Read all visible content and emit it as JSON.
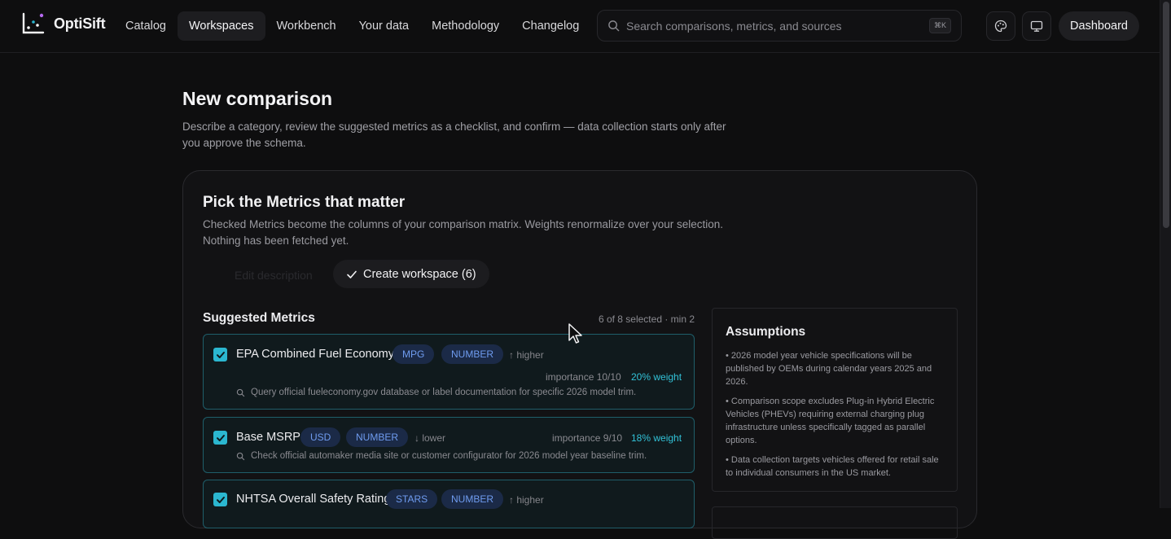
{
  "brand": {
    "name": "OptiSift"
  },
  "nav": [
    {
      "label": "Catalog",
      "active": false
    },
    {
      "label": "Workspaces",
      "active": true
    },
    {
      "label": "Workbench",
      "active": false
    },
    {
      "label": "Your data",
      "active": false
    },
    {
      "label": "Methodology",
      "active": false
    },
    {
      "label": "Changelog",
      "active": false
    }
  ],
  "search": {
    "placeholder": "Search comparisons, metrics, and sources",
    "shortcut": "⌘K"
  },
  "header_actions": {
    "dashboard_label": "Dashboard",
    "theme_icon": "palette-icon",
    "display_icon": "monitor-icon"
  },
  "page": {
    "title": "New comparison",
    "description": "Describe a category, review the suggested metrics as a checklist, and confirm — data collection starts only after you approve the schema."
  },
  "card": {
    "title": "Pick the Metrics that matter",
    "description": "Checked Metrics become the columns of your comparison matrix. Weights renormalize over your selection. Nothing has been fetched yet.",
    "ghost_label": "Edit description",
    "create_label": "Create workspace (6)"
  },
  "suggested": {
    "title": "Suggested Metrics",
    "count": "6 of 8 selected · min 2",
    "metrics": [
      {
        "name": "EPA Combined Fuel Economy",
        "unit": "MPG",
        "type": "NUMBER",
        "direction": "↑ higher",
        "importance": "importance 10/10",
        "weight": "20% weight",
        "hint": "Query official fueleconomy.gov database or label documentation for specific 2026 model trim.",
        "checked": true
      },
      {
        "name": "Base MSRP",
        "unit": "USD",
        "type": "NUMBER",
        "direction": "↓ lower",
        "importance": "importance 9/10",
        "weight": "18% weight",
        "hint": "Check official automaker media site or customer configurator for 2026 model year baseline trim.",
        "checked": true
      },
      {
        "name": "NHTSA Overall Safety Rating",
        "unit": "STARS",
        "type": "NUMBER",
        "direction": "↑ higher",
        "checked": true
      }
    ]
  },
  "assumptions": {
    "title": "Assumptions",
    "items": [
      "• 2026 model year vehicle specifications will be published by OEMs during calendar years 2025 and 2026.",
      "• Comparison scope excludes Plug-in Hybrid Electric Vehicles (PHEVs) requiring external charging plug infrastructure unless specifically tagged as parallel options.",
      "• Data collection targets vehicles offered for retail sale to individual consumers in the US market."
    ]
  },
  "colors": {
    "accent": "#2bb7d0",
    "pill_bg": "#1b2a47",
    "pill_text": "#6f9cf0",
    "metric_border": "#1f5e6a"
  }
}
